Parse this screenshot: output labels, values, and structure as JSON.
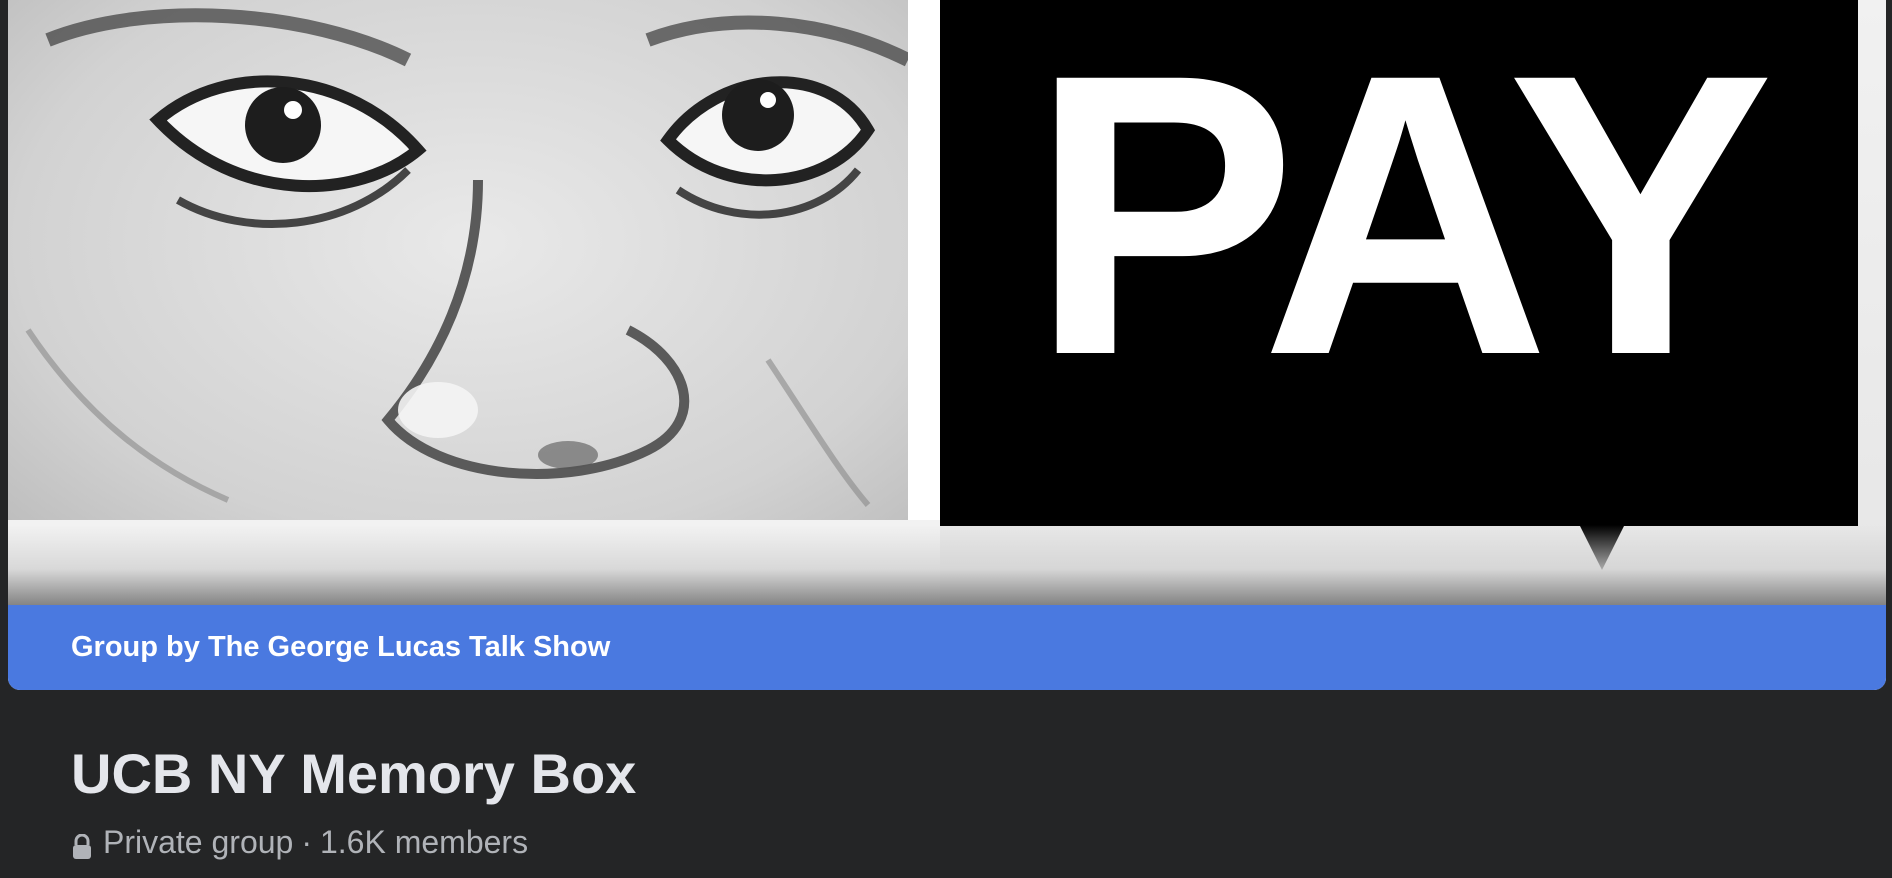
{
  "cover": {
    "pay_text": "PAY",
    "image_icon": "cover-photo"
  },
  "group_bar": {
    "label": "Group by The George Lucas Talk Show",
    "color": "#4a79e0"
  },
  "group": {
    "title": "UCB NY Memory Box",
    "privacy": "Private group",
    "separator": "·",
    "members": "1.6K members",
    "privacy_icon": "lock-icon"
  }
}
